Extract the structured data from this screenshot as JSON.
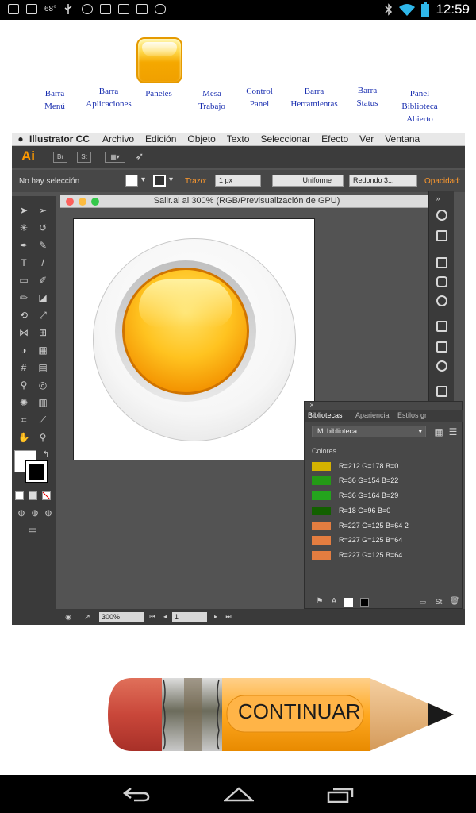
{
  "statusbar": {
    "temperature": "68°",
    "clock": "12:59"
  },
  "top_labels": {
    "menu_bar": [
      "Barra",
      "Menú"
    ],
    "apps_bar": [
      "Barra",
      "Aplicaciones"
    ],
    "panels": [
      "Paneles"
    ],
    "artboard": [
      "Mesa",
      "Trabajo"
    ],
    "control_panel": [
      "Control",
      "Panel"
    ],
    "tools_bar": [
      "Barra",
      "Herramientas"
    ],
    "status_bar": [
      "Barra",
      "Status"
    ],
    "library_panel": [
      "Panel",
      "Biblioteca",
      "Abierto"
    ]
  },
  "illustrator": {
    "menu": {
      "app": "Illustrator CC",
      "items": [
        "Archivo",
        "Edición",
        "Objeto",
        "Texto",
        "Seleccionar",
        "Efecto",
        "Ver",
        "Ventana"
      ]
    },
    "appbar": {
      "logo": "Ai",
      "br": "Br",
      "st": "St"
    },
    "control": {
      "selection": "No hay selección",
      "stroke_label": "Trazo:",
      "stroke_value": "1 px",
      "profile": "Uniforme",
      "brush": "Redondo 3...",
      "opacity_label": "Opacidad:"
    },
    "document_title": "Salir.ai al 300% (RGB/Previsualización de GPU)",
    "library": {
      "tabs": [
        "Bibliotecas",
        "Apariencia",
        "Estilos gr"
      ],
      "selected_library": "Mi biblioteca",
      "colors_heading": "Colores",
      "swatches": [
        {
          "color": "#d4b200",
          "label": "R=212 G=178 B=0"
        },
        {
          "color": "#249a16",
          "label": "R=36 G=154 B=22"
        },
        {
          "color": "#24a41d",
          "label": "R=36 G=164 B=29"
        },
        {
          "color": "#126000",
          "label": "R=18 G=96 B=0"
        },
        {
          "color": "#e37d40",
          "label": "R=227 G=125 B=64 2"
        },
        {
          "color": "#e37d40",
          "label": "R=227 G=125 B=64"
        },
        {
          "color": "#e37d40",
          "label": "R=227 G=125 B=64"
        }
      ]
    },
    "bottom": {
      "zoom": "300%",
      "page": "1"
    }
  },
  "continue_button": {
    "label": "CONTINUAR"
  }
}
